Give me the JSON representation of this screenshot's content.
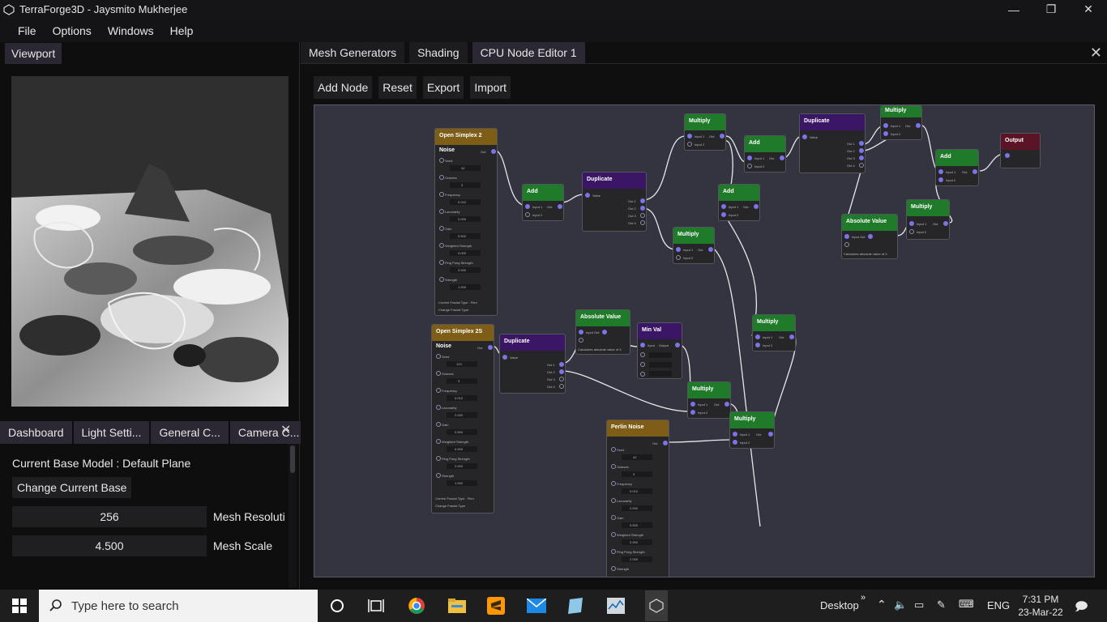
{
  "window": {
    "title": "TerraForge3D - Jaysmito Mukherjee"
  },
  "menu": [
    "File",
    "Options",
    "Windows",
    "Help"
  ],
  "viewport": {
    "tab": "Viewport"
  },
  "dashboard": {
    "tabs": [
      "Dashboard",
      "Light Setti...",
      "General C...",
      "Camera C..."
    ],
    "base_model": "Current Base Model : Default Plane",
    "change_base": "Change Current Base",
    "resolution_value": "256",
    "resolution_label": "Mesh Resoluti",
    "scale_value": "4.500",
    "scale_label": "Mesh Scale"
  },
  "editor": {
    "tabs": [
      "Mesh Generators",
      "Shading",
      "CPU Node Editor 1"
    ],
    "toolbar": [
      "Add Node",
      "Reset",
      "Export",
      "Import"
    ]
  },
  "nodes": {
    "simplex2": {
      "title": "Open Simplex 2 Noise",
      "out": "Out",
      "params": [
        "Seed",
        "Octaves",
        "Frequency",
        "Lacunarity",
        "Gain",
        "Weighted Strength",
        "Ping Pong Strength",
        "Strength"
      ],
      "values": [
        "42",
        "3",
        "0.010",
        "2.000",
        "0.500",
        "0.000",
        "2.000",
        "1.000"
      ],
      "footer1": "Current Fractal Type : Fbm",
      "footer2": "Change Fractal Type"
    },
    "simplex2s": {
      "title": "Open Simplex 2S Noise",
      "out": "Out",
      "params": [
        "Seed",
        "Octaves",
        "Frequency",
        "Lacunarity",
        "Gain",
        "Weighted Strength",
        "Ping Pong Strength",
        "Strength"
      ],
      "values": [
        "123",
        "3",
        "0.010",
        "2.000",
        "0.500",
        "0.000",
        "2.000",
        "1.000"
      ],
      "footer1": "Current Fractal Type : Fbm",
      "footer2": "Change Fractal Type"
    },
    "perlin": {
      "title": "Perlin Noise",
      "out": "Out",
      "params": [
        "Seed",
        "Octaves",
        "Frequency",
        "Lacunarity",
        "Gain",
        "Weighted Strength",
        "Ping Pong Strength",
        "Strength"
      ],
      "values": [
        "42",
        "3",
        "0.010",
        "2.000",
        "0.500",
        "0.000",
        "2.000",
        ""
      ]
    },
    "add1": {
      "title": "Add",
      "in1": "Input 1",
      "in1v": "Out",
      "in2": "Input 2"
    },
    "add2": {
      "title": "Add",
      "in1": "Input 1",
      "in1v": "Out",
      "in2": "Input 2"
    },
    "add3": {
      "title": "Add",
      "in1": "Input 1",
      "in1v": "Out",
      "in2": "Input 2"
    },
    "add4": {
      "title": "Add",
      "in1": "Input 1",
      "in1v": "Out",
      "in2": "Input 2"
    },
    "dup1": {
      "title": "Duplicate",
      "in": "Value",
      "outs": [
        "Out 1",
        "Out 2",
        "Out 3",
        "Out 4"
      ]
    },
    "dup2": {
      "title": "Duplicate",
      "in": "Value",
      "outs": [
        "Out 1",
        "Out 2",
        "Out 3",
        "Out 4"
      ]
    },
    "dup3": {
      "title": "Duplicate",
      "in": "Value",
      "outs": [
        "Out 1",
        "Out 2",
        "Out 3",
        "Out 4"
      ]
    },
    "mul1": {
      "title": "Multiply",
      "in1": "Input 1",
      "in1v": "Out",
      "in2": "Input 2"
    },
    "mul2": {
      "title": "Multiply",
      "in1": "Input 1",
      "in1v": "Out",
      "in2": "Input 2"
    },
    "mul3": {
      "title": "Multiply",
      "in1": "Input 1",
      "in1v": "Out",
      "in2": "Input 2"
    },
    "mul4": {
      "title": "Multiply",
      "in1": "Input 1",
      "in1v": "Out",
      "in2": "Input 2"
    },
    "mul5": {
      "title": "Multiply",
      "in1": "Input 1",
      "in1v": "Out",
      "in2": "Input 2"
    },
    "mul6": {
      "title": "Multiply",
      "in1": "Input 1",
      "in1v": "Out",
      "in2": "Input 2"
    },
    "mul7": {
      "title": "Multiply",
      "in1": "Input 1",
      "in1v": "Out",
      "in2": "Input 2"
    },
    "abs1": {
      "title": "Absolute Value",
      "in": "Input",
      "inv": "Out",
      "note": "Calculates absolute value of X"
    },
    "abs2": {
      "title": "Absolute Value",
      "in": "Input",
      "inv": "Out",
      "note": "Calculates absolute value of X"
    },
    "minval": {
      "title": "Min Val",
      "in": "Input",
      "inv": "Output"
    },
    "output": {
      "title": "Output"
    }
  },
  "taskbar": {
    "search_placeholder": "Type here to search",
    "desktop": "Desktop",
    "lang": "ENG",
    "time": "7:31 PM",
    "date": "23-Mar-22"
  },
  "colors": {
    "header_green": "#1f7a2a",
    "header_purple": "#3b1566",
    "header_gold": "#7e5d17",
    "header_red": "#5a1426",
    "pin": "#7b74e6",
    "canvas": "#343440",
    "tab": "#2b2733"
  }
}
